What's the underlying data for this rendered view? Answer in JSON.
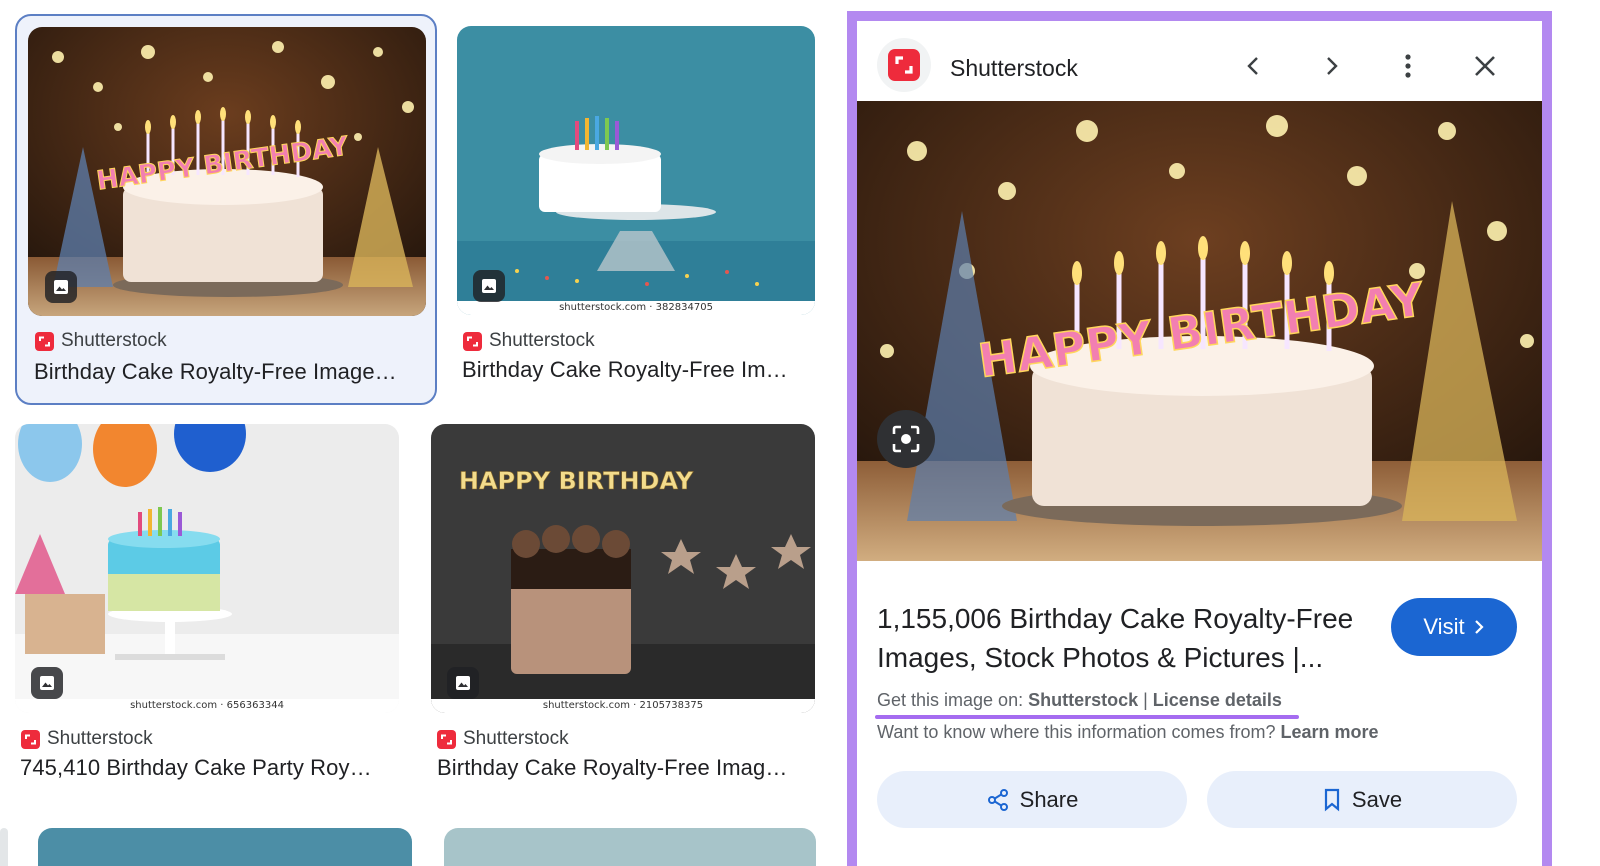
{
  "colors": {
    "panel_highlight": "#b389f0",
    "selected_card_border": "#5c7fc4",
    "brand_red": "#ee2b3c",
    "visit_blue": "#1b66d2",
    "action_pill": "#e8effb",
    "underline_mark": "#a56cf0"
  },
  "results": [
    {
      "thumb": "Cake with Happy Birthday candles and party hats",
      "thumb_lettering": "HAPPY BIRTHDAY",
      "source": "Shutterstock",
      "title": "Birthday Cake Royalty-Free Image…",
      "watermark": "",
      "selected": true
    },
    {
      "thumb": "White cake on stand with colorful candles, teal background",
      "source": "Shutterstock",
      "title": "Birthday Cake Royalty-Free Im…",
      "watermark": "shutterstock.com · 382834705",
      "selected": false
    },
    {
      "thumb": "Blue cake with sprinkles and balloons",
      "source": "Shutterstock",
      "title": "745,410 Birthday Cake Party Roy…",
      "watermark": "shutterstock.com · 656363344",
      "selected": false
    },
    {
      "thumb": "Chocolate drip cake with Happy Birthday topper",
      "thumb_lettering": "HAPPY BIRTHDAY",
      "source": "Shutterstock",
      "title": "Birthday Cake Royalty-Free Imag…",
      "watermark": "shutterstock.com · 2105738375",
      "selected": false
    }
  ],
  "panel": {
    "source_name": "Shutterstock",
    "icons": {
      "prev": "chevron-left-icon",
      "next": "chevron-right-icon",
      "more": "more-vert-icon",
      "close": "close-icon",
      "lens": "google-lens-icon"
    },
    "image_lettering": "HAPPY BIRTHDAY",
    "title": "1,155,006 Birthday Cake Royalty-Free Images, Stock Photos & Pictures |...",
    "visit_label": "Visit",
    "get_image_prefix": "Get this image on: ",
    "get_image_source": "Shutterstock",
    "separator": " | ",
    "license_label": "License details",
    "info_question": "Want to know where this information comes from? ",
    "learn_more": "Learn more",
    "share_label": "Share",
    "save_label": "Save"
  }
}
